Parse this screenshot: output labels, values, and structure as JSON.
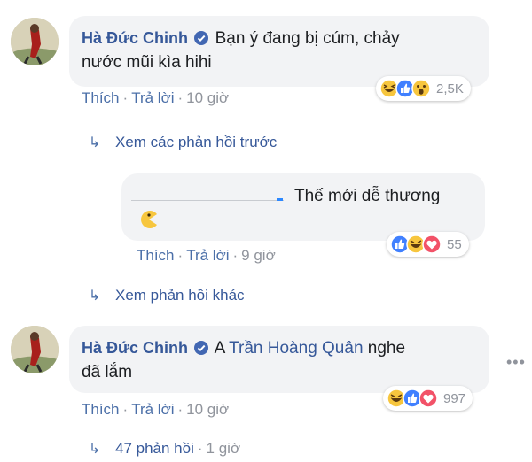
{
  "comments": [
    {
      "author": "Hà Đức Chinh",
      "line1": "Bạn ý đang bị cúm, chảy",
      "line2": "nước mũi kìa hihi",
      "like_label": "Thích",
      "reply_label": "Trả lời",
      "time": "10 giờ",
      "reaction_count": "2,5K",
      "reactions": [
        "haha-icon",
        "like-icon",
        "wow-icon"
      ]
    },
    {
      "author": "Hà Đức Chinh",
      "prefix": "A ",
      "mention": "Trần Hoàng Quân",
      "line1_suffix": " nghe",
      "line2": "đã lắm",
      "like_label": "Thích",
      "reply_label": "Trả lời",
      "time": "10 giờ",
      "reaction_count": "997",
      "reactions": [
        "haha-icon",
        "like-icon",
        "love-icon"
      ]
    }
  ],
  "previous_replies_label": "Xem các phản hồi trước",
  "reply": {
    "text": "Thế mới dễ thương",
    "like_label": "Thích",
    "reply_label": "Trả lời",
    "time": "9 giờ",
    "reaction_count": "55",
    "reactions": [
      "like-icon",
      "haha-icon",
      "love-icon"
    ]
  },
  "other_replies_label": "Xem phản hồi khác",
  "footer": {
    "replies_label": "47 phản hồi",
    "time": "1 giờ"
  },
  "more_options": "•••",
  "colors": {
    "link": "#365899",
    "bubble": "#f2f3f5",
    "meta": "#90949c",
    "like": "#4080ff",
    "love": "#f25268",
    "yellow": "#f7c63e"
  }
}
